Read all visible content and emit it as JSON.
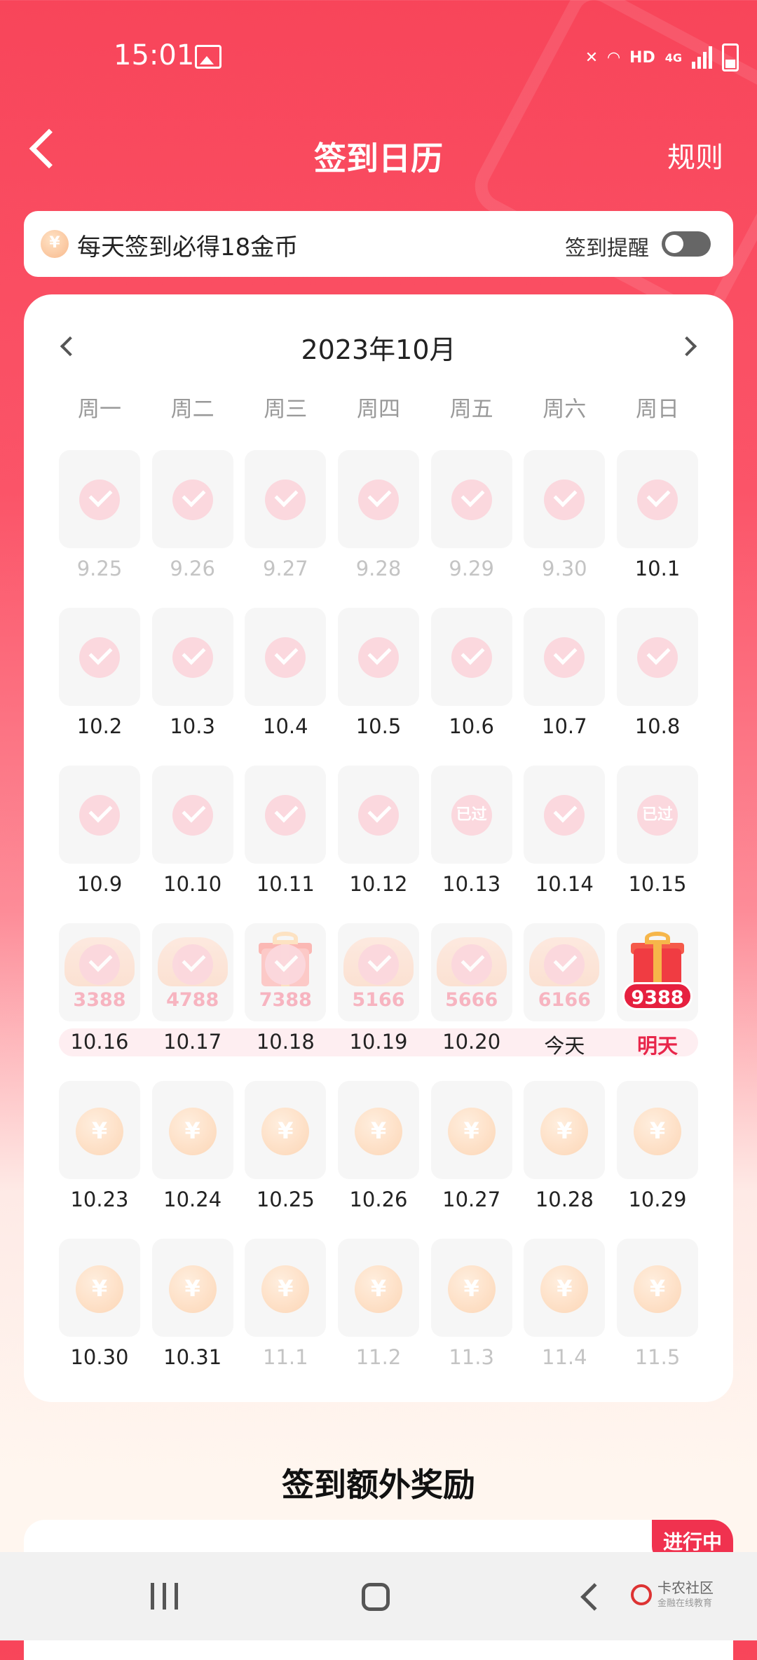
{
  "status_bar": {
    "time": "15:01",
    "network": "HD",
    "cell": "4G"
  },
  "header": {
    "title": "签到日历",
    "rules": "规则"
  },
  "banner": {
    "text": "每天签到必得18金币",
    "remind_label": "签到提醒",
    "remind_on": false
  },
  "calendar": {
    "month": "2023年10月",
    "weekdays": [
      "周一",
      "周二",
      "周三",
      "周四",
      "周五",
      "周六",
      "周日"
    ],
    "weeks": [
      [
        {
          "date": "9.25",
          "state": "checked",
          "faded": true
        },
        {
          "date": "9.26",
          "state": "checked",
          "faded": true
        },
        {
          "date": "9.27",
          "state": "checked",
          "faded": true
        },
        {
          "date": "9.28",
          "state": "checked",
          "faded": true
        },
        {
          "date": "9.29",
          "state": "checked",
          "faded": true
        },
        {
          "date": "9.30",
          "state": "checked",
          "faded": true
        },
        {
          "date": "10.1",
          "state": "checked"
        }
      ],
      [
        {
          "date": "10.2",
          "state": "checked"
        },
        {
          "date": "10.3",
          "state": "checked"
        },
        {
          "date": "10.4",
          "state": "checked"
        },
        {
          "date": "10.5",
          "state": "checked"
        },
        {
          "date": "10.6",
          "state": "checked"
        },
        {
          "date": "10.7",
          "state": "checked"
        },
        {
          "date": "10.8",
          "state": "checked"
        }
      ],
      [
        {
          "date": "10.9",
          "state": "checked"
        },
        {
          "date": "10.10",
          "state": "checked"
        },
        {
          "date": "10.11",
          "state": "checked"
        },
        {
          "date": "10.12",
          "state": "checked"
        },
        {
          "date": "10.13",
          "state": "past",
          "tag": "已过"
        },
        {
          "date": "10.14",
          "state": "checked"
        },
        {
          "date": "10.15",
          "state": "past",
          "tag": "已过"
        }
      ],
      [
        {
          "date": "10.16",
          "state": "reward",
          "icon": "coins",
          "amount": "3388"
        },
        {
          "date": "10.17",
          "state": "reward",
          "icon": "coins",
          "amount": "4788"
        },
        {
          "date": "10.18",
          "state": "reward",
          "icon": "gift",
          "amount": "7388"
        },
        {
          "date": "10.19",
          "state": "reward",
          "icon": "coins",
          "amount": "5166"
        },
        {
          "date": "10.20",
          "state": "reward",
          "icon": "coins",
          "amount": "5666"
        },
        {
          "date": "今天",
          "state": "reward",
          "icon": "coins",
          "amount": "6166"
        },
        {
          "date": "明天",
          "state": "gift_big",
          "icon": "gift",
          "amount": "9388",
          "highlight": true
        }
      ],
      [
        {
          "date": "10.23",
          "state": "coin"
        },
        {
          "date": "10.24",
          "state": "coin"
        },
        {
          "date": "10.25",
          "state": "coin"
        },
        {
          "date": "10.26",
          "state": "coin"
        },
        {
          "date": "10.27",
          "state": "coin"
        },
        {
          "date": "10.28",
          "state": "coin"
        },
        {
          "date": "10.29",
          "state": "coin"
        }
      ],
      [
        {
          "date": "10.30",
          "state": "coin"
        },
        {
          "date": "10.31",
          "state": "coin"
        },
        {
          "date": "11.1",
          "state": "coin",
          "faded": true
        },
        {
          "date": "11.2",
          "state": "coin",
          "faded": true
        },
        {
          "date": "11.3",
          "state": "coin",
          "faded": true
        },
        {
          "date": "11.4",
          "state": "coin",
          "faded": true
        },
        {
          "date": "11.5",
          "state": "coin",
          "faded": true
        }
      ]
    ]
  },
  "extra": {
    "title": "签到额外奖励",
    "badge": "进行中"
  },
  "watermark": {
    "name": "卡农社区",
    "sub": "金融在线教育"
  },
  "colors": {
    "accent": "#f8455a",
    "check_pink": "#fbd8de",
    "highlight_red": "#e6203f"
  }
}
